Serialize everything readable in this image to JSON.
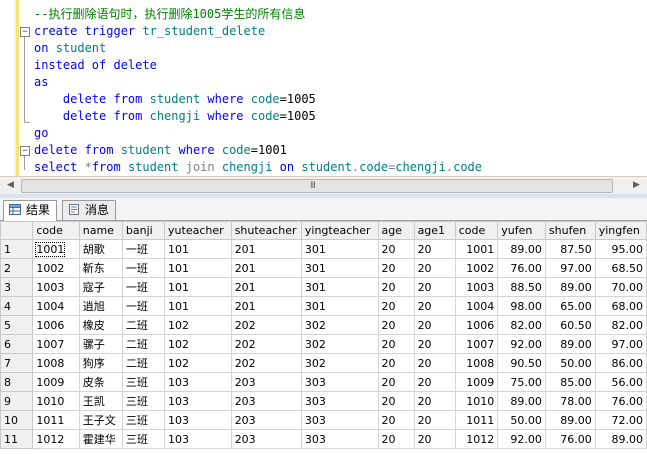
{
  "editor": {
    "lines": [
      {
        "parts": [
          {
            "t": "--执行删除语句时，执行删除1005学生的所有信息",
            "c": "cm"
          }
        ]
      },
      {
        "parts": [
          {
            "t": "create trigger ",
            "c": "kw"
          },
          {
            "t": "tr_student_delete",
            "c": "tl"
          }
        ]
      },
      {
        "parts": [
          {
            "t": "on ",
            "c": "kw"
          },
          {
            "t": "student",
            "c": "tl"
          }
        ]
      },
      {
        "parts": [
          {
            "t": "instead of delete",
            "c": "kw"
          }
        ]
      },
      {
        "parts": [
          {
            "t": "as",
            "c": "kw"
          }
        ]
      },
      {
        "parts": [
          {
            "t": "    delete from ",
            "c": "kw"
          },
          {
            "t": "student ",
            "c": "tl"
          },
          {
            "t": "where ",
            "c": "kw"
          },
          {
            "t": "code",
            "c": "tl"
          },
          {
            "t": "=1005",
            "c": ""
          }
        ]
      },
      {
        "parts": [
          {
            "t": "    delete from ",
            "c": "kw"
          },
          {
            "t": "chengji ",
            "c": "tl"
          },
          {
            "t": "where ",
            "c": "kw"
          },
          {
            "t": "code",
            "c": "tl"
          },
          {
            "t": "=1005",
            "c": ""
          }
        ]
      },
      {
        "parts": [
          {
            "t": "go",
            "c": "kw"
          }
        ]
      },
      {
        "parts": [
          {
            "t": "delete from ",
            "c": "kw"
          },
          {
            "t": "student ",
            "c": "tl"
          },
          {
            "t": "where ",
            "c": "kw"
          },
          {
            "t": "code",
            "c": "tl"
          },
          {
            "t": "=1001",
            "c": ""
          }
        ]
      },
      {
        "parts": [
          {
            "t": "select ",
            "c": "kw"
          },
          {
            "t": "*",
            "c": "gr"
          },
          {
            "t": "from ",
            "c": "kw"
          },
          {
            "t": "student ",
            "c": "tl"
          },
          {
            "t": "join ",
            "c": "gr"
          },
          {
            "t": "chengji ",
            "c": "tl"
          },
          {
            "t": "on ",
            "c": "kw"
          },
          {
            "t": "student",
            "c": "tl"
          },
          {
            "t": ".",
            "c": "gr"
          },
          {
            "t": "code",
            "c": "tl"
          },
          {
            "t": "=",
            "c": "gr"
          },
          {
            "t": "chengji",
            "c": "tl"
          },
          {
            "t": ".",
            "c": "gr"
          },
          {
            "t": "code",
            "c": "tl"
          }
        ]
      }
    ]
  },
  "scrollbar": {
    "left_arrow": "◀",
    "right_arrow": "▶",
    "grip": "III"
  },
  "tabs": [
    {
      "label": "结果",
      "icon": "results-grid-icon",
      "active": true
    },
    {
      "label": "消息",
      "icon": "messages-icon",
      "active": false
    }
  ],
  "results": {
    "columns": [
      "code",
      "name",
      "banji",
      "yuteacher",
      "shuteacher",
      "yingteacher",
      "age",
      "age1",
      "code",
      "yufen",
      "shufen",
      "yingfen"
    ],
    "rows": [
      [
        "1",
        "1001",
        "胡歌",
        "一班",
        "101",
        "201",
        "301",
        "20",
        "20",
        "1001",
        "89.00",
        "87.50",
        "95.00"
      ],
      [
        "2",
        "1002",
        "靳东",
        "一班",
        "101",
        "201",
        "301",
        "20",
        "20",
        "1002",
        "76.00",
        "97.00",
        "68.50"
      ],
      [
        "3",
        "1003",
        "寇子",
        "一班",
        "101",
        "201",
        "301",
        "20",
        "20",
        "1003",
        "88.50",
        "89.00",
        "70.00"
      ],
      [
        "4",
        "1004",
        "逍旭",
        "一班",
        "101",
        "201",
        "301",
        "20",
        "20",
        "1004",
        "98.00",
        "65.00",
        "68.00"
      ],
      [
        "5",
        "1006",
        "橡皮",
        "二班",
        "102",
        "202",
        "302",
        "20",
        "20",
        "1006",
        "82.00",
        "60.50",
        "82.00"
      ],
      [
        "6",
        "1007",
        "骡子",
        "二班",
        "102",
        "202",
        "302",
        "20",
        "20",
        "1007",
        "92.00",
        "89.00",
        "97.00"
      ],
      [
        "7",
        "1008",
        "狗序",
        "二班",
        "102",
        "202",
        "302",
        "20",
        "20",
        "1008",
        "90.50",
        "50.00",
        "86.00"
      ],
      [
        "8",
        "1009",
        "皮条",
        "三班",
        "103",
        "203",
        "303",
        "20",
        "20",
        "1009",
        "75.00",
        "85.00",
        "56.00"
      ],
      [
        "9",
        "1010",
        "王凯",
        "三班",
        "103",
        "203",
        "303",
        "20",
        "20",
        "1010",
        "89.00",
        "78.00",
        "76.00"
      ],
      [
        "10",
        "1011",
        "王子文",
        "三班",
        "103",
        "203",
        "303",
        "20",
        "20",
        "1011",
        "50.00",
        "89.00",
        "72.00"
      ],
      [
        "11",
        "1012",
        "霍建华",
        "三班",
        "103",
        "203",
        "303",
        "20",
        "20",
        "1012",
        "92.00",
        "76.00",
        "89.00"
      ]
    ]
  }
}
